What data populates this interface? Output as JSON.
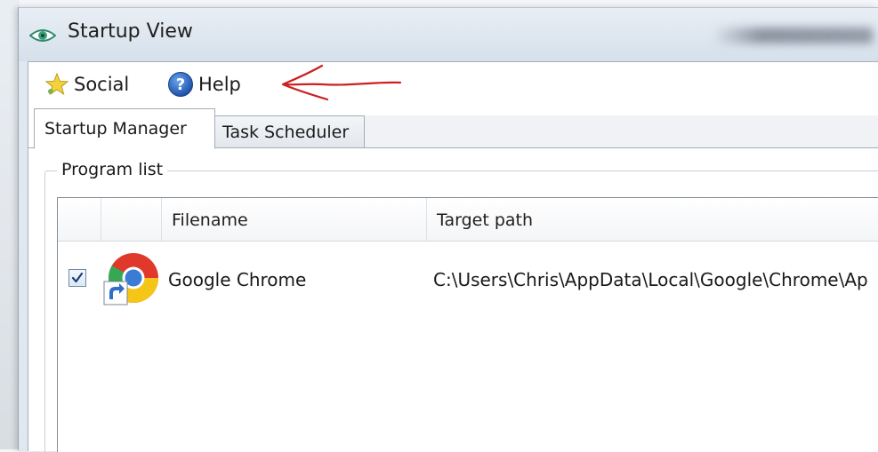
{
  "window": {
    "title": "Startup View"
  },
  "menu": {
    "items": [
      {
        "label": "Social",
        "icon": "star-icon"
      },
      {
        "label": "Help",
        "icon": "help-icon"
      }
    ]
  },
  "annotation": {
    "arrow_color": "#cc1f1f"
  },
  "tabs": [
    {
      "label": "Startup Manager",
      "selected": true
    },
    {
      "label": "Task Scheduler",
      "selected": false
    }
  ],
  "program_list": {
    "legend": "Program list",
    "columns": [
      "Filename",
      "Target path"
    ],
    "rows": [
      {
        "checked": true,
        "icon": "google-chrome-shortcut-icon",
        "filename": "Google Chrome",
        "target_path": "C:\\Users\\Chris\\AppData\\Local\\Google\\Chrome\\Ap"
      }
    ]
  }
}
